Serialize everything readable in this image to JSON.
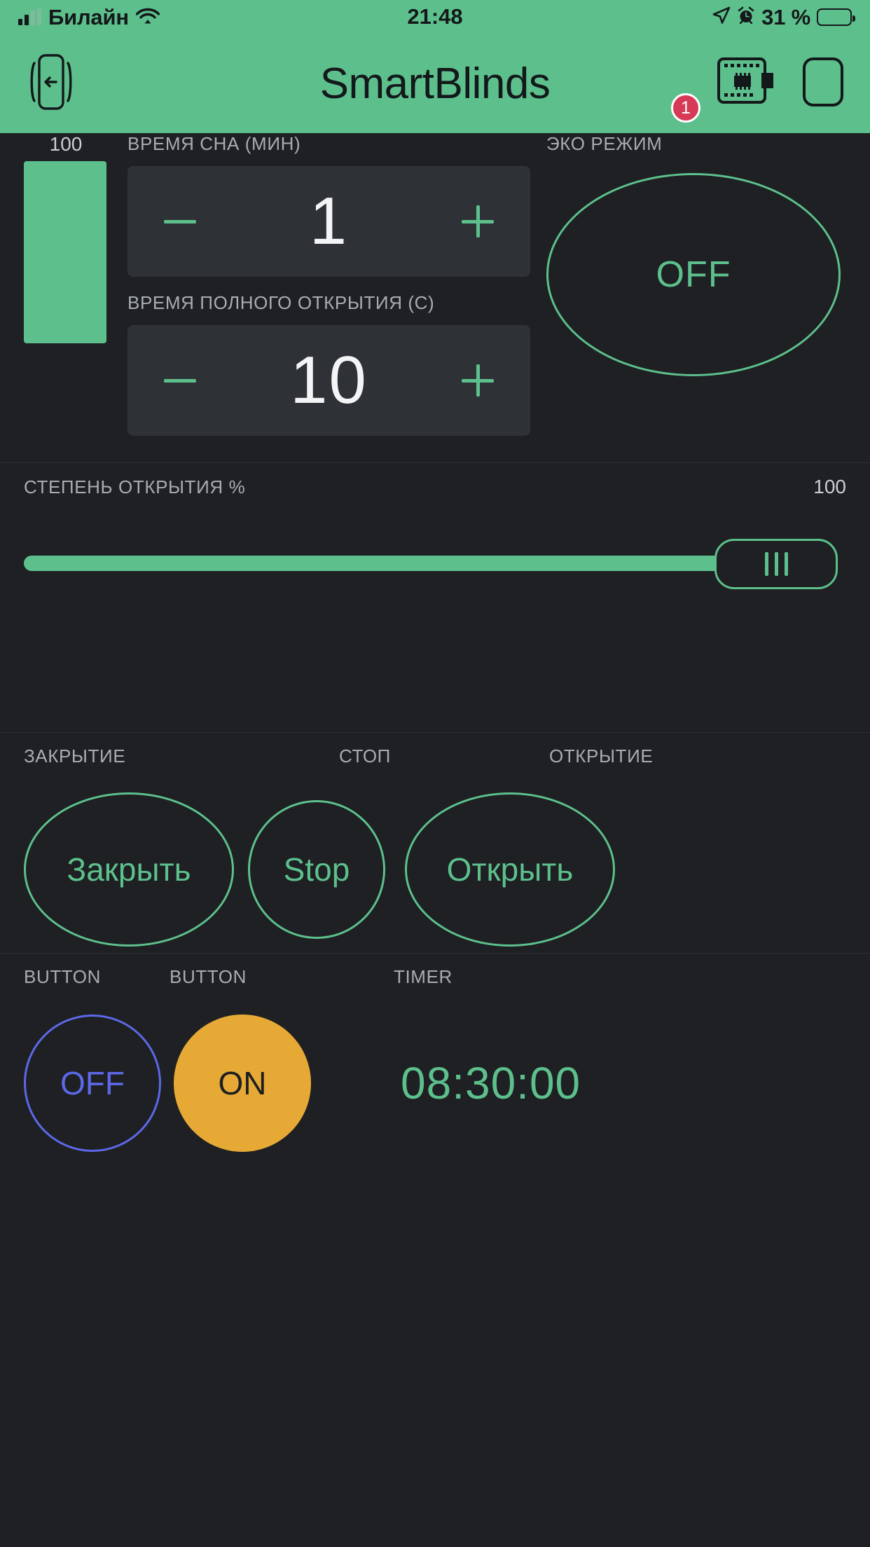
{
  "status_bar": {
    "carrier": "Билайн",
    "time": "21:48",
    "battery_percent": "31 %",
    "icons": [
      "signal-bars-icon",
      "wifi-icon",
      "location-arrow-icon",
      "alarm-clock-icon",
      "battery-icon"
    ]
  },
  "nav_bar": {
    "title": "SmartBlinds",
    "back_icon": "device-back-icon",
    "chip_icon": "microcontroller-board-icon",
    "chip_badge": "1",
    "device_icon": "phone-outline-icon",
    "background_color": "#5DC08C"
  },
  "gauge": {
    "value": "100"
  },
  "sleep_time": {
    "label": "ВРЕМЯ СНА (МИН)",
    "value": "1",
    "minus_label": "−",
    "plus_label": "+"
  },
  "full_open_time": {
    "label": "ВРЕМЯ ПОЛНОГО ОТКРЫТИЯ (С)",
    "value": "10",
    "minus_label": "−",
    "plus_label": "+"
  },
  "eco_mode": {
    "label": "ЭКО РЕЖИМ",
    "state": "OFF"
  },
  "open_degree": {
    "label": "СТЕПЕНЬ ОТКРЫТИЯ %",
    "value": "100"
  },
  "actions": {
    "close_label": "ЗАКРЫТИЕ",
    "stop_label": "СТОП",
    "open_label": "ОТКРЫТИЕ",
    "close_button": "Закрыть",
    "stop_button": "Stop",
    "open_button": "Открыть"
  },
  "bottom": {
    "button1_label": "BUTTON",
    "button2_label": "BUTTON",
    "timer_label": "TIMER",
    "button1_state": "OFF",
    "button2_state": "ON",
    "timer_value": "08:30:00"
  },
  "colors": {
    "accent_green": "#5DC08C",
    "accent_blue": "#5C68E8",
    "accent_orange": "#E7A936",
    "background": "#1e2023",
    "panel": "#2e3135"
  }
}
